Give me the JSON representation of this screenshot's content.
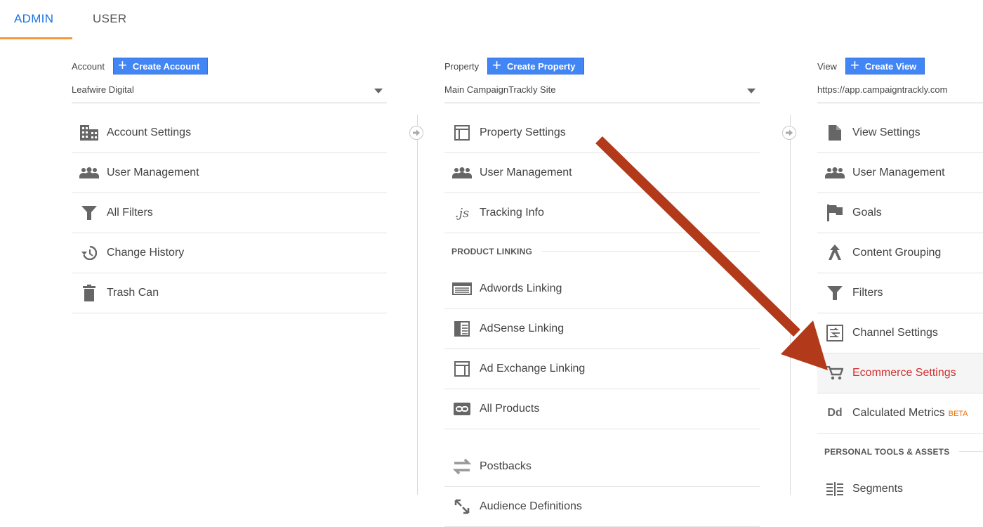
{
  "tabs": {
    "admin": "ADMIN",
    "user": "USER"
  },
  "account": {
    "label": "Account",
    "create_label": "Create Account",
    "selected": "Leafwire Digital",
    "items": [
      {
        "label": "Account Settings",
        "icon": "building-icon"
      },
      {
        "label": "User Management",
        "icon": "people-icon"
      },
      {
        "label": "All Filters",
        "icon": "filter-icon"
      },
      {
        "label": "Change History",
        "icon": "history-icon"
      },
      {
        "label": "Trash Can",
        "icon": "trash-icon"
      }
    ]
  },
  "property": {
    "label": "Property",
    "create_label": "Create Property",
    "selected": "Main CampaignTrackly Site",
    "items": [
      {
        "label": "Property Settings",
        "icon": "layout-icon"
      },
      {
        "label": "User Management",
        "icon": "people-icon"
      },
      {
        "label": "Tracking Info",
        "icon": "js-icon"
      }
    ],
    "section_label": "PRODUCT LINKING",
    "linking_items": [
      {
        "label": "Adwords Linking",
        "icon": "adwords-icon"
      },
      {
        "label": "AdSense Linking",
        "icon": "adsense-icon"
      },
      {
        "label": "Ad Exchange Linking",
        "icon": "adexchange-icon"
      },
      {
        "label": "All Products",
        "icon": "link-icon"
      }
    ],
    "extra_items": [
      {
        "label": "Postbacks",
        "icon": "postbacks-icon"
      },
      {
        "label": "Audience Definitions",
        "icon": "audience-icon"
      }
    ]
  },
  "view": {
    "label": "View",
    "create_label": "Create View",
    "selected": "https://app.campaigntrackly.com",
    "items": [
      {
        "label": "View Settings",
        "icon": "document-icon"
      },
      {
        "label": "User Management",
        "icon": "people-icon"
      },
      {
        "label": "Goals",
        "icon": "flag-icon"
      },
      {
        "label": "Content Grouping",
        "icon": "content-grouping-icon"
      },
      {
        "label": "Filters",
        "icon": "filter-icon"
      },
      {
        "label": "Channel Settings",
        "icon": "channel-icon"
      },
      {
        "label": "Ecommerce Settings",
        "icon": "cart-icon"
      },
      {
        "label": "Calculated Metrics",
        "icon": "dd-icon",
        "badge": "BETA"
      }
    ],
    "section_label": "PERSONAL TOOLS & ASSETS",
    "tools_items": [
      {
        "label": "Segments",
        "icon": "segments-icon"
      }
    ]
  },
  "colors": {
    "accent": "#1a73e8",
    "button": "#4285f4",
    "active_text": "#d32f2f",
    "tab_underline": "#f29b38",
    "arrow": "#b23a1a"
  }
}
